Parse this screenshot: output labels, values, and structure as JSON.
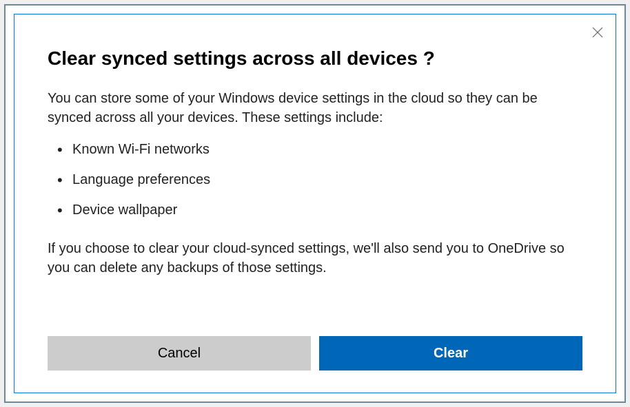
{
  "dialog": {
    "title": "Clear synced settings across all devices ?",
    "intro": "You can store some of your Windows device settings in the cloud so they can be synced across all your devices. These settings include:",
    "bullets": {
      "b0": "Known Wi-Fi networks",
      "b1": "Language preferences",
      "b2": "Device wallpaper"
    },
    "footer": "If you choose to clear your cloud-synced settings, we'll also send you to OneDrive so you can delete any backups of those settings.",
    "buttons": {
      "cancel": "Cancel",
      "confirm": "Clear"
    }
  }
}
